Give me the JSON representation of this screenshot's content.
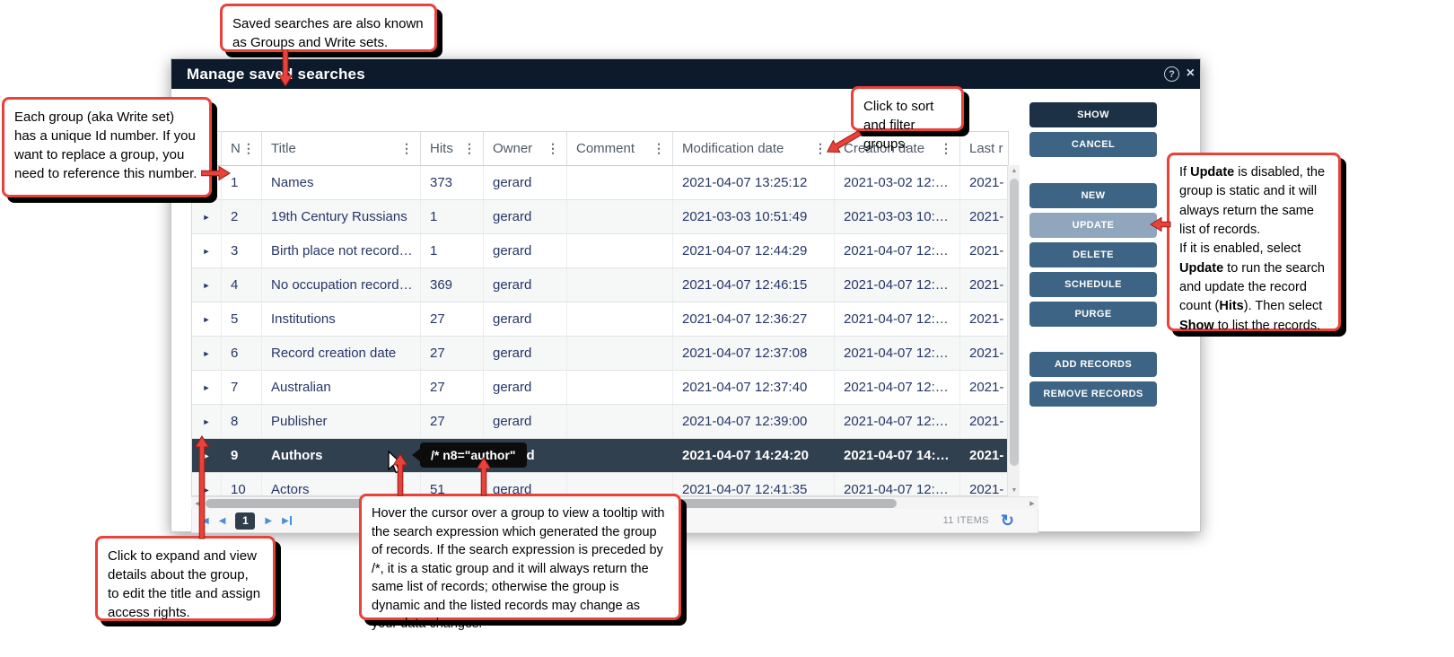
{
  "window": {
    "title": "Manage saved searches"
  },
  "icons": {
    "help": "?",
    "close": "×",
    "column_menu": "⋮",
    "expand_row": "►",
    "page_first_tri": "◀",
    "page_prev": "◀",
    "page_next": "▶",
    "page_last_tri": "▶",
    "scroll_up": "▲",
    "scroll_down": "▼",
    "scroll_left": "◀",
    "scroll_right": "▶",
    "refresh": "↻"
  },
  "table": {
    "columns": [
      {
        "label": "N"
      },
      {
        "label": "Title"
      },
      {
        "label": "Hits"
      },
      {
        "label": "Owner"
      },
      {
        "label": "Comment"
      },
      {
        "label": "Modification date"
      },
      {
        "label": "Creation date"
      },
      {
        "label": "Last r"
      }
    ],
    "rows": [
      {
        "n": "1",
        "title": "Names",
        "hits": "373",
        "owner": "gerard",
        "comment": "",
        "modified": "2021-04-07 13:25:12",
        "created": "2021-03-02 12:…",
        "last": "2021-",
        "selected": false
      },
      {
        "n": "2",
        "title": "19th Century Russians",
        "hits": "1",
        "owner": "gerard",
        "comment": "",
        "modified": "2021-03-03 10:51:49",
        "created": "2021-03-03 10:…",
        "last": "2021-",
        "selected": false
      },
      {
        "n": "3",
        "title": "Birth place not record…",
        "hits": "1",
        "owner": "gerard",
        "comment": "",
        "modified": "2021-04-07 12:44:29",
        "created": "2021-04-07 12:…",
        "last": "2021-",
        "selected": false
      },
      {
        "n": "4",
        "title": "No occupation record…",
        "hits": "369",
        "owner": "gerard",
        "comment": "",
        "modified": "2021-04-07 12:46:15",
        "created": "2021-04-07 12:…",
        "last": "2021-",
        "selected": false
      },
      {
        "n": "5",
        "title": "Institutions",
        "hits": "27",
        "owner": "gerard",
        "comment": "",
        "modified": "2021-04-07 12:36:27",
        "created": "2021-04-07 12:…",
        "last": "2021-",
        "selected": false
      },
      {
        "n": "6",
        "title": "Record creation date",
        "hits": "27",
        "owner": "gerard",
        "comment": "",
        "modified": "2021-04-07 12:37:08",
        "created": "2021-04-07 12:…",
        "last": "2021-",
        "selected": false
      },
      {
        "n": "7",
        "title": "Australian",
        "hits": "27",
        "owner": "gerard",
        "comment": "",
        "modified": "2021-04-07 12:37:40",
        "created": "2021-04-07 12:…",
        "last": "2021-",
        "selected": false
      },
      {
        "n": "8",
        "title": "Publisher",
        "hits": "27",
        "owner": "gerard",
        "comment": "",
        "modified": "2021-04-07 12:39:00",
        "created": "2021-04-07 12:…",
        "last": "2021-",
        "selected": false
      },
      {
        "n": "9",
        "title": "Authors",
        "hits": "",
        "owner": "gerard",
        "comment": "",
        "modified": "2021-04-07 14:24:20",
        "created": "2021-04-07 14:…",
        "last": "2021-",
        "selected": true
      },
      {
        "n": "10",
        "title": "Actors",
        "hits": "51",
        "owner": "gerard",
        "comment": "",
        "modified": "2021-04-07 12:41:35",
        "created": "2021-04-07 12:…",
        "last": "2021-",
        "selected": false
      }
    ],
    "selected_tooltip": "/* n8=\"author\""
  },
  "footer": {
    "items_label": "11 ITEMS",
    "page": "1"
  },
  "actions": {
    "show": "SHOW",
    "cancel": "CANCEL",
    "new": "NEW",
    "update": "UPDATE",
    "delete": "DELETE",
    "schedule": "SCHEDULE",
    "purge": "PURGE",
    "add_records": "ADD RECORDS",
    "remove_records": "REMOVE RECORDS"
  },
  "callouts": {
    "saved_searches": "Saved searches are also known as Groups and Write sets.",
    "unique_id": "Each group (aka Write set) has a unique Id number.  If you want to replace a group, you need to reference this number.",
    "sort": "Click to sort and filter groups.",
    "update": {
      "seg1": "If ",
      "seg2": "Update",
      "seg3": " is disabled, the group is static and it will always return the same list of records.\nIf it is enabled, select ",
      "seg4": "Update",
      "seg5": " to run the search and update the record count (",
      "seg6": "Hits",
      "seg7": "). Then select ",
      "seg8": "Show",
      "seg9": " to list the records."
    },
    "expand": "Click to expand and view details about the group, to edit the title and assign access rights.",
    "hover": "Hover the cursor over a group to view a tooltip with the search expression which generated the group of records. If the search expression is preceded by /*, it is a static group and it will always return the same list of records; otherwise the group is dynamic and the listed records may change as your data changes."
  },
  "colors": {
    "accent_red": "#e8423b",
    "titlebar": "#0c1a2b",
    "button_primary": "#1c3046",
    "button_steel": "#3d6484",
    "button_disabled": "#8fa6bc",
    "selected_row": "#31404f",
    "cell_text": "#263667"
  }
}
